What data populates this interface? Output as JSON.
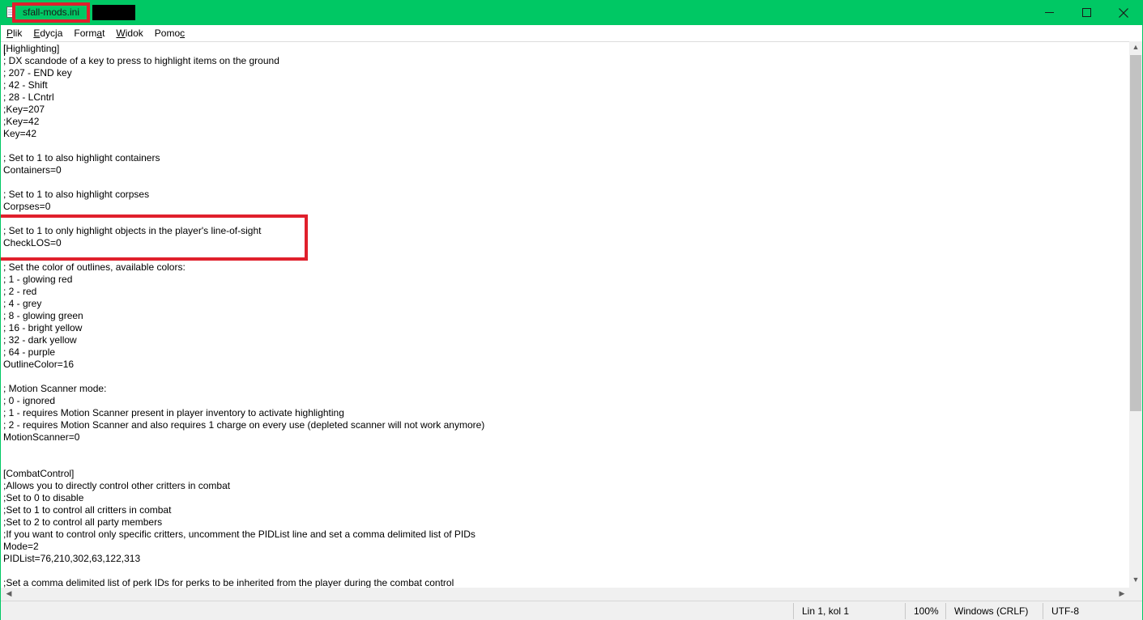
{
  "window": {
    "title": "sfall-mods.ini",
    "accent_color": "#00c864",
    "highlight_color": "#e0202c",
    "controls": {
      "minimize_icon": "minimize-icon",
      "maximize_icon": "maximize-icon",
      "close_icon": "close-icon"
    }
  },
  "menu": {
    "items": [
      {
        "pre": "",
        "u": "P",
        "post": "lik"
      },
      {
        "pre": "",
        "u": "E",
        "post": "dycja"
      },
      {
        "pre": "Form",
        "u": "a",
        "post": "t"
      },
      {
        "pre": "",
        "u": "W",
        "post": "idok"
      },
      {
        "pre": "Pomo",
        "u": "c",
        "post": ""
      }
    ]
  },
  "editor": {
    "lines": [
      "[Highlighting]",
      "; DX scandode of a key to press to highlight items on the ground",
      "; 207 - END key",
      "; 42 - Shift",
      "; 28 - LCntrl",
      ";Key=207",
      ";Key=42",
      "Key=42",
      "",
      "; Set to 1 to also highlight containers",
      "Containers=0",
      "",
      "; Set to 1 to also highlight corpses",
      "Corpses=0",
      "",
      "; Set to 1 to only highlight objects in the player's line-of-sight",
      "CheckLOS=0",
      "",
      "; Set the color of outlines, available colors:",
      "; 1 - glowing red",
      "; 2 - red",
      "; 4 - grey",
      "; 8 - glowing green",
      "; 16 - bright yellow",
      "; 32 - dark yellow",
      "; 64 - purple",
      "OutlineColor=16",
      "",
      "; Motion Scanner mode:",
      "; 0 - ignored",
      "; 1 - requires Motion Scanner present in player inventory to activate highlighting",
      "; 2 - requires Motion Scanner and also requires 1 charge on every use (depleted scanner will not work anymore)",
      "MotionScanner=0",
      "",
      "",
      "[CombatControl]",
      ";Allows you to directly control other critters in combat",
      ";Set to 0 to disable",
      ";Set to 1 to control all critters in combat",
      ";Set to 2 to control all party members",
      ";If you want to control only specific critters, uncomment the PIDList line and set a comma delimited list of PIDs",
      "Mode=2",
      "PIDList=76,210,302,63,122,313",
      "",
      ";Set a comma delimited list of perk IDs for perks to be inherited from the player during the combat control"
    ]
  },
  "status": {
    "position": "Lin 1, kol 1",
    "zoom": "100%",
    "line_ending": "Windows (CRLF)",
    "encoding": "UTF-8"
  }
}
